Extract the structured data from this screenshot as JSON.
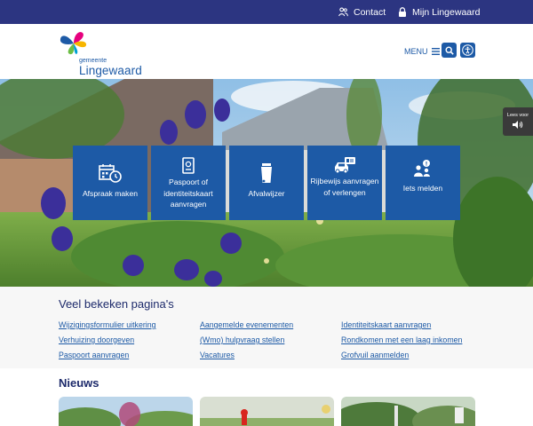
{
  "topbar": {
    "contact": "Contact",
    "mijn": "Mijn Lingewaard"
  },
  "logo": {
    "small": "gemeente",
    "name": "Lingewaard"
  },
  "header": {
    "menu": "MENU"
  },
  "hero": {
    "lees_voor": "Lees voor"
  },
  "tiles": [
    {
      "label": "Afspraak maken",
      "icon": "calendar-clock-icon"
    },
    {
      "label": "Paspoort of identiteitskaart aanvragen",
      "icon": "passport-icon"
    },
    {
      "label": "Afvalwijzer",
      "icon": "waste-bin-icon"
    },
    {
      "label": "Rijbewijs aanvragen of verlengen",
      "icon": "car-license-icon"
    },
    {
      "label": "Iets melden",
      "icon": "report-person-icon"
    }
  ],
  "popular": {
    "title": "Veel bekeken pagina's",
    "links": [
      "Wijzigingsformulier uitkering",
      "Aangemelde evenementen",
      "Identiteitskaart aanvragen",
      "Verhuizing doorgeven",
      "(Wmo) hulpvraag stellen",
      "Rondkomen met een laag inkomen",
      "Paspoort aanvragen",
      "Vacatures",
      "Grofvuil aanmelden"
    ]
  },
  "news": {
    "title": "Nieuws"
  },
  "colors": {
    "topbar": "#2c3581",
    "accent": "#1d5aa6",
    "heading": "#1d2a6b"
  }
}
